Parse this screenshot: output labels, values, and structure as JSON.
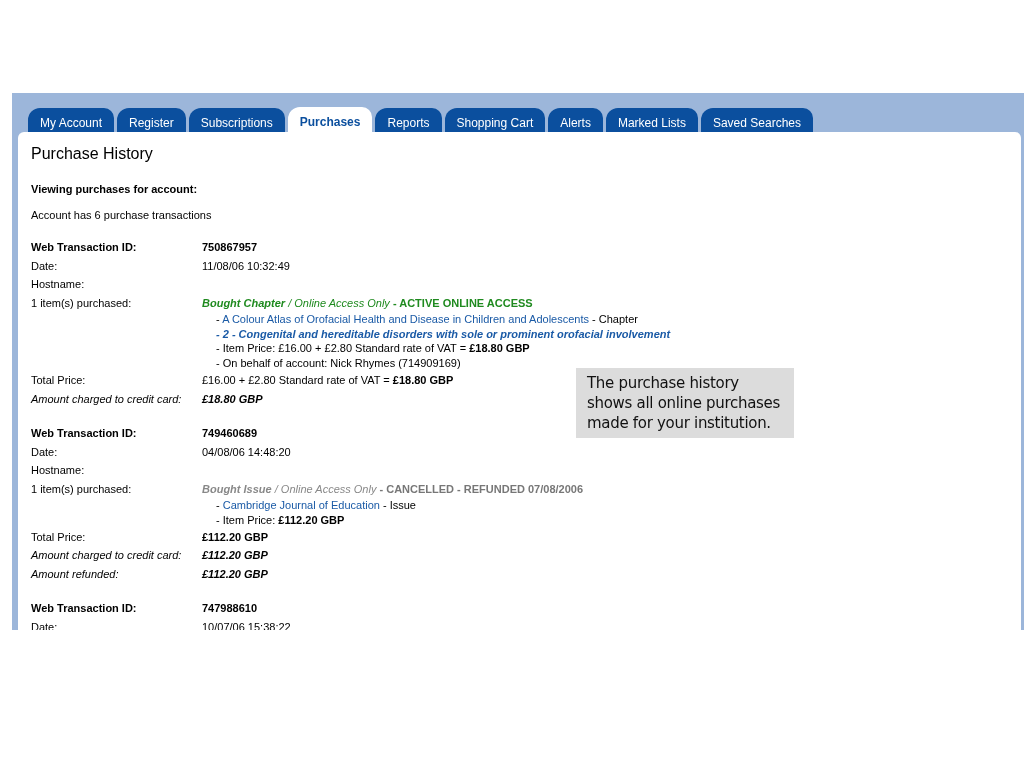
{
  "tabs": [
    {
      "label": "My Account",
      "selected": false
    },
    {
      "label": "Register",
      "selected": false
    },
    {
      "label": "Subscriptions",
      "selected": false
    },
    {
      "label": "Purchases",
      "selected": true
    },
    {
      "label": "Reports",
      "selected": false
    },
    {
      "label": "Shopping Cart",
      "selected": false
    },
    {
      "label": "Alerts",
      "selected": false
    },
    {
      "label": "Marked Lists",
      "selected": false
    },
    {
      "label": "Saved Searches",
      "selected": false
    }
  ],
  "heading": "Purchase History",
  "account_label": "Viewing purchases for account:",
  "transactions_count": "Account has 6 purchase transactions",
  "transactions": [
    {
      "rows": [
        {
          "kind": "id",
          "label": "Web Transaction ID:",
          "value": "750867957"
        },
        {
          "kind": "plain",
          "label": "Date:",
          "value": "11/08/06 10:32:49"
        },
        {
          "kind": "plain",
          "label": "Hostname:"
        },
        {
          "kind": "items",
          "label": "1 item(s) purchased:",
          "status": {
            "type": "Bought Chapter",
            "access": "/ Online Access Only",
            "state": "- ACTIVE ONLINE ACCESS",
            "active": true
          },
          "details": [
            {
              "kind": "link",
              "dash": "-",
              "link": "A Colour Atlas of Orofacial Health and Disease in Children and Adolescents",
              "suffix": "- Chapter"
            },
            {
              "kind": "chapter",
              "text": "- 2 - Congenital and hereditable disorders with sole or prominent orofacial involvement"
            },
            {
              "kind": "text",
              "text": "- Item Price: £16.00 + £2.80 Standard rate of VAT = **£18.80 GBP**"
            },
            {
              "kind": "text",
              "text": "- On behalf of account: Nick Rhymes (714909169)"
            }
          ]
        },
        {
          "kind": "plain",
          "label": "Total Price:",
          "value": "£16.00 + £2.80 Standard rate of VAT = **£18.80 GBP**"
        },
        {
          "kind": "italic",
          "label": "Amount charged to credit card:",
          "value": "£18.80 GBP"
        }
      ]
    },
    {
      "rows": [
        {
          "kind": "id",
          "label": "Web Transaction ID:",
          "value": "749460689"
        },
        {
          "kind": "plain",
          "label": "Date:",
          "value": "04/08/06 14:48:20"
        },
        {
          "kind": "plain",
          "label": "Hostname:"
        },
        {
          "kind": "items",
          "label": "1 item(s) purchased:",
          "status": {
            "type": "Bought Issue",
            "access": "/ Online Access Only",
            "state": "- CANCELLED - REFUNDED 07/08/2006",
            "active": false
          },
          "details": [
            {
              "kind": "link",
              "dash": "-",
              "link": "Cambridge Journal of Education",
              "suffix": "- Issue"
            },
            {
              "kind": "text",
              "text": "- Item Price: **£112.20 GBP**"
            }
          ]
        },
        {
          "kind": "plain",
          "label": "Total Price:",
          "value": "**£112.20 GBP**"
        },
        {
          "kind": "italic",
          "label": "Amount charged to credit card:",
          "value": "£112.20 GBP"
        },
        {
          "kind": "italic",
          "label": "Amount refunded:",
          "value": "£112.20 GBP"
        }
      ]
    },
    {
      "rows": [
        {
          "kind": "id",
          "label": "Web Transaction ID:",
          "value": "747988610"
        },
        {
          "kind": "plain",
          "label": "Date:",
          "value": "10/07/06 15:38:22"
        }
      ]
    }
  ],
  "note": "The purchase history shows all online purchases made for your institution."
}
